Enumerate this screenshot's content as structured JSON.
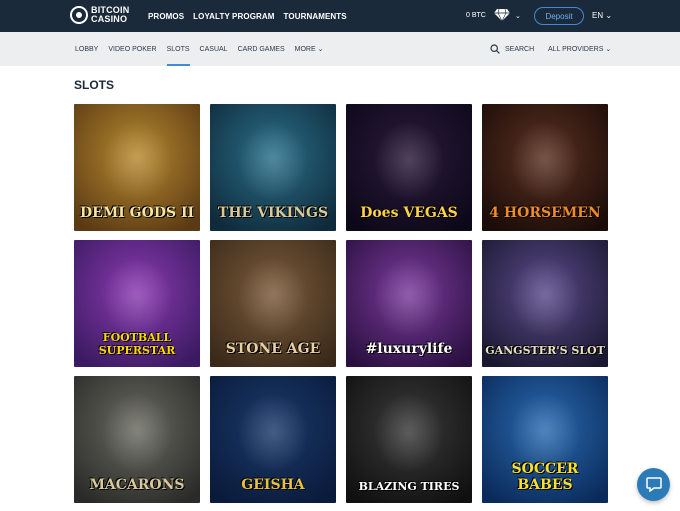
{
  "header": {
    "logo_line1": "BITCOIN",
    "logo_line2": "CASINO",
    "nav": [
      "PROMOS",
      "LOYALTY PROGRAM",
      "TOURNAMENTS"
    ],
    "balance": "0 BTC",
    "deposit_label": "Deposit",
    "language": "EN",
    "caret": "⌄"
  },
  "subnav": {
    "items": [
      "LOBBY",
      "VIDEO POKER",
      "SLOTS",
      "CASUAL",
      "CARD GAMES",
      "MORE ⌄"
    ],
    "active_index": 2,
    "search_label": "SEARCH",
    "providers_label": "ALL PROVIDERS ⌄"
  },
  "section": {
    "title": "SLOTS"
  },
  "games": [
    {
      "title": "DEMI GODS II",
      "bg": "#b8892f",
      "bg2": "#5a3a14",
      "color": "#f4e4a0"
    },
    {
      "title": "THE VIKINGS",
      "bg": "#2a6f8a",
      "bg2": "#0f2a3a",
      "color": "#d8c89a"
    },
    {
      "title": "Does VEGAS",
      "bg": "#2a1a3a",
      "bg2": "#0c0818",
      "color": "#ffd24a"
    },
    {
      "title": "4 HORSEMEN",
      "bg": "#5a3020",
      "bg2": "#1a0c08",
      "color": "#f08a2a"
    },
    {
      "title": "FOOTBALL SUPERSTAR",
      "bg": "#8a3ab0",
      "bg2": "#3a1a60",
      "color": "#ffd800"
    },
    {
      "title": "STONE AGE",
      "bg": "#7a5a3a",
      "bg2": "#3a2a1a",
      "color": "#e8d0a0"
    },
    {
      "title": "#luxurylife",
      "bg": "#7a3a9a",
      "bg2": "#2a1040",
      "color": "#ffffff"
    },
    {
      "title": "GANGSTER'S SLOT",
      "bg": "#5a4a8a",
      "bg2": "#1a1830",
      "color": "#e8e0c0"
    },
    {
      "title": "MACARONS",
      "bg": "#6a6a62",
      "bg2": "#2a2a28",
      "color": "#d8c89a"
    },
    {
      "title": "GEISHA",
      "bg": "#1a3a6a",
      "bg2": "#0a1a3a",
      "color": "#e8c040"
    },
    {
      "title": "BLAZING TIRES",
      "bg": "#3a3a3a",
      "bg2": "#101010",
      "color": "#ffffff"
    },
    {
      "title": "SOCCER BABES",
      "bg": "#2a6ab0",
      "bg2": "#0a2a5a",
      "color": "#f8e030"
    }
  ]
}
